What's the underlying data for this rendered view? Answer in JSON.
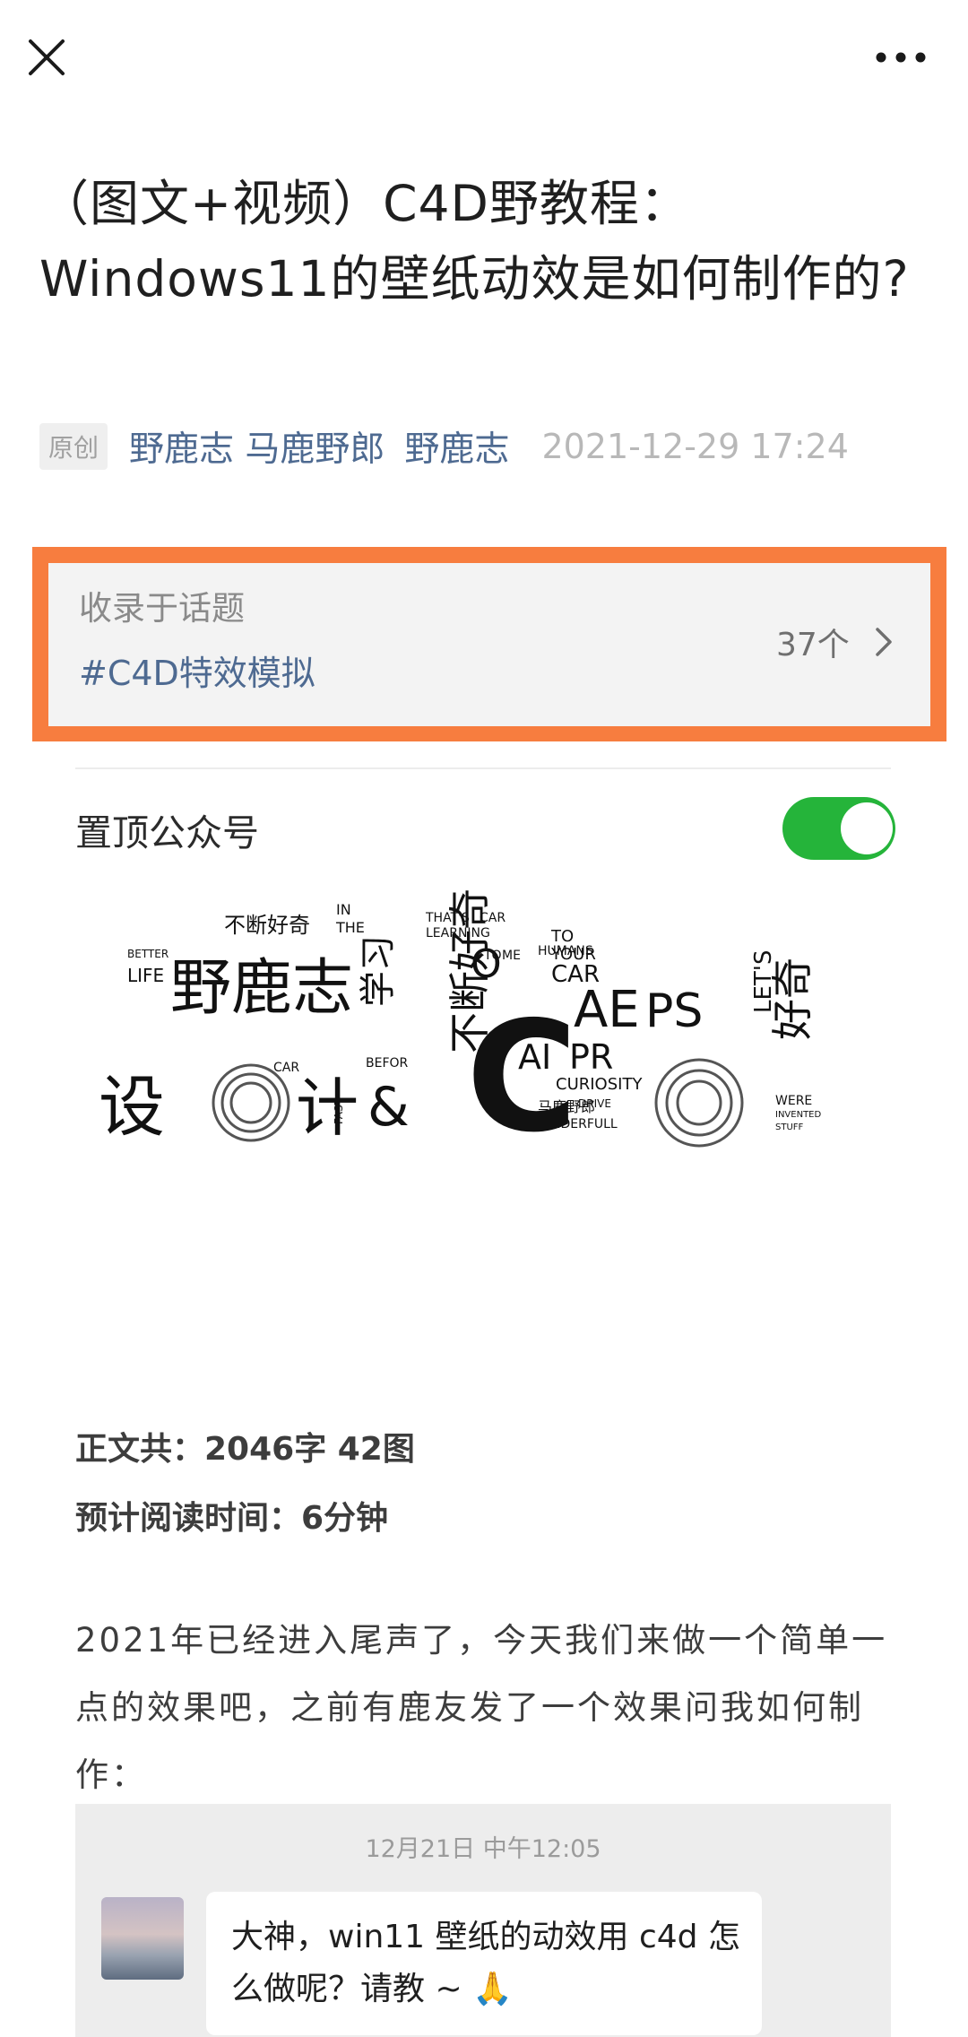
{
  "header": {
    "close_icon": "close-icon",
    "more_icon": "more-icon"
  },
  "article": {
    "title": "（图文+视频）C4D野教程：Windows11的壁纸动效是如何制作的?",
    "badge": "原创",
    "author": "野鹿志 马鹿野郎",
    "account": "野鹿志",
    "date": "2021-12-29 17:24"
  },
  "topic": {
    "label": "收录于话题",
    "tag": "#C4D特效模拟",
    "count": "37个"
  },
  "pin": {
    "label": "置顶公众号",
    "toggle_on": true
  },
  "wordcloud": {
    "words": [
      "不断好奇",
      "IN",
      "THE",
      "THAT'S",
      "CAR",
      "LEARNING",
      "BETTER",
      "LIFE",
      "野鹿志",
      "学习",
      "不断好奇",
      "TO",
      "ME",
      "HUMANS",
      "TO",
      "YOUR",
      "CAR",
      "AE",
      "PS",
      "AI",
      "PR",
      "CURIOSITY",
      "LET'S",
      "好奇",
      "设",
      "计",
      "&",
      "BEFOR",
      "CAR",
      "FAST",
      "马鹿野郎",
      "DRIVE",
      "NDERFULL",
      "WERE",
      "INVENTED",
      "STUFF",
      "C",
      "O"
    ]
  },
  "stats": {
    "word_count": "正文共：2046字 42图",
    "read_time": "预计阅读时间：6分钟"
  },
  "body": {
    "paragraph": "2021年已经进入尾声了，今天我们来做一个简单一点的效果吧，之前有鹿友发了一个效果问我如何制作："
  },
  "chat": {
    "time": "12月21日 中午12:05",
    "message": "大神，win11 壁纸的动效用 c4d 怎么做呢？请教 ~ 🙏"
  },
  "colors": {
    "link": "#4e6a91",
    "highlight_border": "#f77d3f",
    "toggle": "#25b43a"
  }
}
